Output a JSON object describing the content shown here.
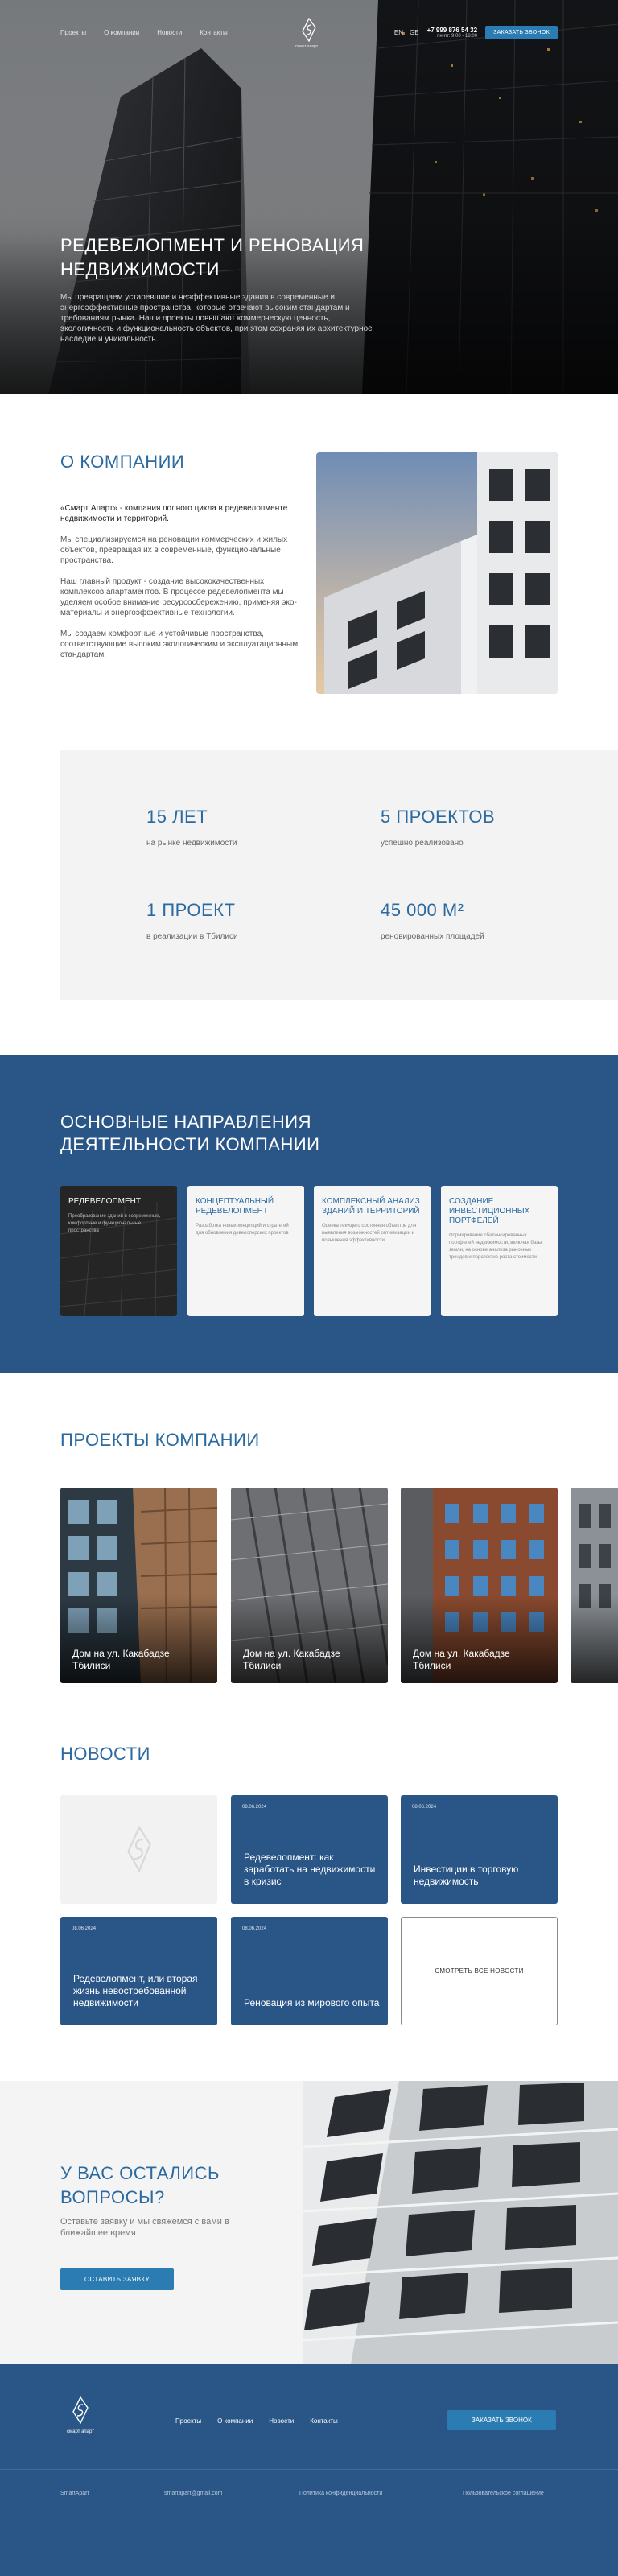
{
  "nav": {
    "links": [
      "Проекты",
      "О компании",
      "Новости",
      "Контакты"
    ],
    "logo_text": "смарт апарт",
    "lang": [
      "EN",
      "GE"
    ],
    "phone": "+7 999 876 54 32",
    "hours": "пн-пт: 9:00 - 18:00",
    "call_button": "ЗАКАЗАТЬ ЗВОНОК"
  },
  "hero": {
    "title": "РЕДЕВЕЛОПМЕНТ И РЕНОВАЦИЯ НЕДВИЖИМОСТИ",
    "text": "Мы превращаем устаревшие и неэффективные здания в современные и энергоэффективные пространства, которые отвечают высоким стандартам и требованиям рынка. Наши проекты повышают коммерческую ценность, экологичность и функциональность объектов, при этом сохраняя их архитектурное наследие и уникальность."
  },
  "about": {
    "title": "О КОМПАНИИ",
    "lead": "«Смарт Апарт» - компания полного цикла в редевелопменте недвижимости и территорий.",
    "p1": "Мы специализируемся на реновации коммерческих и жилых объектов, превращая их в современные, функциональные пространства.",
    "p2": "Наш главный продукт - создание высококачественных комплексов апартаментов. В процессе редевелопмента мы уделяем особое внимание ресурсосбережению, применяя эко-материалы и энергоэффективные технологии.",
    "p3": "Мы создаем комфортные и устойчивые пространства, соответствующие высоким экологическим и эксплуатационным стандартам."
  },
  "stats": [
    {
      "value": "15 ЛЕТ",
      "label": "на рынке недвижимости"
    },
    {
      "value": "5 ПРОЕКТОВ",
      "label": "успешно реализовано"
    },
    {
      "value": "1 ПРОЕКТ",
      "label": "в реализации в Тбилиси"
    },
    {
      "value": "45 000 М²",
      "label": "реновированных площадей"
    }
  ],
  "directions": {
    "title": "ОСНОВНЫЕ НАПРАВЛЕНИЯ ДЕЯТЕЛЬНОСТИ КОМПАНИИ",
    "cards": [
      {
        "title": "РЕДЕВЕЛОПМЕНТ",
        "desc": "Преобразование зданий в современные, комфортные и функциональные пространства"
      },
      {
        "title": "КОНЦЕПТУАЛЬНЫЙ РЕДЕВЕЛОПМЕНТ",
        "desc": "Разработка новых концепций и стратегий для обновления девелоперских проектов"
      },
      {
        "title": "КОМПЛЕКСНЫЙ АНАЛИЗ ЗДАНИЙ И ТЕРРИТОРИЙ",
        "desc": "Оценка текущего состояния объектов для выявления возможностей оптимизации и повышения эффективности"
      },
      {
        "title": "СОЗДАНИЕ ИНВЕСТИЦИОННЫХ ПОРТФЕЛЕЙ",
        "desc": "Формирование сбалансированных портфелей недвижимости, включая базы, земли, на основе анализа рыночных трендов и перспектив роста стоимости"
      }
    ]
  },
  "projects": {
    "title": "ПРОЕКТЫ КОМПАНИИ",
    "items": [
      {
        "caption": "Дом на ул. Какабадзе Тбилиси"
      },
      {
        "caption": "Дом на ул. Какабадзе Тбилиси"
      },
      {
        "caption": "Дом на ул. Какабадзе Тбилиси"
      }
    ]
  },
  "news": {
    "title": "НОВОСТИ",
    "items": [
      {
        "date": "08.06.2024",
        "title": "Редевелопмент: как заработать на недвижимости в кризис"
      },
      {
        "date": "08.06.2024",
        "title": "Инвестиции в торговую недвижимость"
      },
      {
        "date": "08.06.2024",
        "title": "Редевелопмент, или вторая жизнь невостребованной недвижимости"
      },
      {
        "date": "08.06.2024",
        "title": "Реновация из мирового опыта"
      }
    ],
    "all_label": "СМОТРЕТЬ ВСЕ НОВОСТИ"
  },
  "cta": {
    "title": "У ВАС ОСТАЛИСЬ ВОПРОСЫ?",
    "text": "Оставьте заявку и мы свяжемся с вами в ближайшее время",
    "button": "ОСТАВИТЬ ЗАЯВКУ"
  },
  "footer": {
    "logo_text": "смарт апарт",
    "links": [
      "Проекты",
      "О компании",
      "Новости",
      "Контакты"
    ],
    "call_button": "ЗАКАЗАТЬ ЗВОНОК",
    "company": "SmartApart",
    "email": "smartapart@gmail.com",
    "privacy": "Политика конфиденциальности",
    "terms": "Пользовательское соглашение"
  },
  "colors": {
    "primary": "#2a5687",
    "accent": "#2a7cb3",
    "title": "#2a6aa0"
  }
}
